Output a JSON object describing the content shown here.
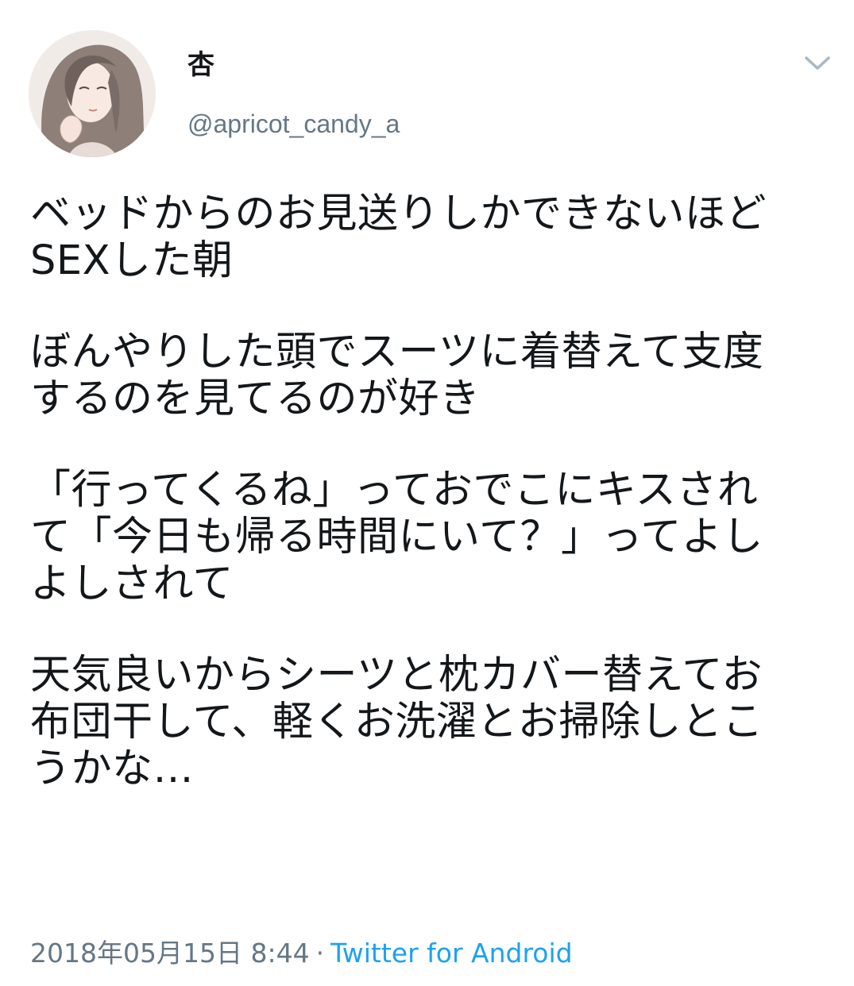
{
  "user": {
    "display_name": "杏",
    "handle": "@apricot_candy_a",
    "avatar_icon": "profile-illustration-icon"
  },
  "menu": {
    "caret_icon": "chevron-down-icon"
  },
  "tweet": {
    "paragraphs": [
      [
        "ベッドからのお見送りしかできないほど",
        "SEXした朝"
      ],
      [
        "ぼんやりした頭でスーツに着替えて支度",
        "するのを見てるのが好き"
      ],
      [
        "「行ってくるね」っておでこにキスされ",
        "て「今日も帰る時間にいて？」ってよし",
        "よしされて"
      ],
      [
        "天気良いからシーツと枕カバー替えてお",
        "布団干して、軽くお洗濯とお掃除しとこ",
        "うかな…"
      ]
    ]
  },
  "meta": {
    "timestamp": "2018年05月15日 8:44",
    "separator": "·",
    "source": "Twitter for Android"
  },
  "colors": {
    "text": "#14171a",
    "secondary": "#657786",
    "link": "#1da1f2"
  }
}
